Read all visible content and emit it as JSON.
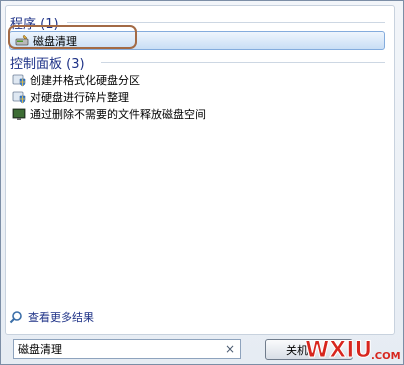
{
  "programs_group": {
    "header": "程序 (1)",
    "items": [
      {
        "label": "磁盘清理",
        "icon": "disk-cleanup-icon"
      }
    ]
  },
  "control_panel_group": {
    "header": "控制面板 (3)",
    "items": [
      {
        "label": "创建并格式化硬盘分区",
        "icon": "control-panel-shield-icon"
      },
      {
        "label": "对硬盘进行碎片整理",
        "icon": "control-panel-shield-icon"
      },
      {
        "label": "通过删除不需要的文件释放磁盘空间",
        "icon": "control-panel-monitor-icon"
      }
    ]
  },
  "see_more": {
    "label": "查看更多结果",
    "icon": "search-icon"
  },
  "search": {
    "value": "磁盘清理",
    "clear_glyph": "×"
  },
  "shutdown_button": {
    "label": "关机"
  },
  "watermark": {
    "text": "WXIU.COM"
  },
  "colors": {
    "group_header": "#1e3287",
    "selection_border": "#84acdd",
    "highlight_ring": "#a36a45",
    "watermark_red": "#d7261e"
  }
}
